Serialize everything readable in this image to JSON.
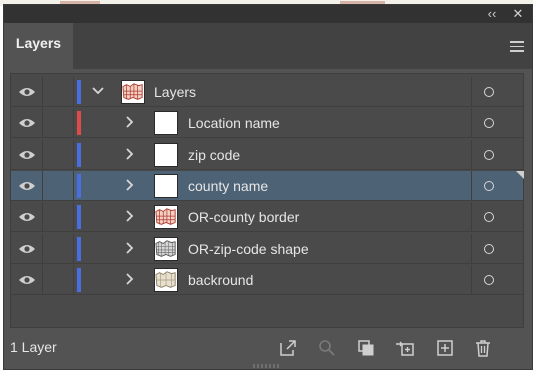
{
  "window": {
    "collapse_glyph": "‹‹",
    "close_glyph": "✕"
  },
  "panel": {
    "tab_label": "Layers",
    "menu_icon": "hamburger-menu-icon"
  },
  "layers": [
    {
      "name": "Layers",
      "color": "#4a6ee0",
      "level": 0,
      "expanded": true,
      "thumbnail": "map-red",
      "selected": false
    },
    {
      "name": "Location name",
      "color": "#e04a4a",
      "level": 1,
      "expanded": false,
      "thumbnail": "blank",
      "selected": false
    },
    {
      "name": "zip code",
      "color": "#4a6ee0",
      "level": 1,
      "expanded": false,
      "thumbnail": "blank",
      "selected": false
    },
    {
      "name": "county name",
      "color": "#4a6ee0",
      "level": 1,
      "expanded": false,
      "thumbnail": "blank",
      "selected": true
    },
    {
      "name": "OR-county border",
      "color": "#4a6ee0",
      "level": 1,
      "expanded": false,
      "thumbnail": "map-red",
      "selected": false
    },
    {
      "name": "OR-zip-code shape",
      "color": "#4a6ee0",
      "level": 1,
      "expanded": false,
      "thumbnail": "map-gray",
      "selected": false
    },
    {
      "name": "backround",
      "color": "#4a6ee0",
      "level": 1,
      "expanded": false,
      "thumbnail": "map-beige",
      "selected": false
    }
  ],
  "footer": {
    "layer_count": "1 Layer",
    "icons": [
      "export-icon",
      "search-icon",
      "collect-icon",
      "move-selection-icon",
      "new-sublayer-icon",
      "trash-icon"
    ]
  }
}
